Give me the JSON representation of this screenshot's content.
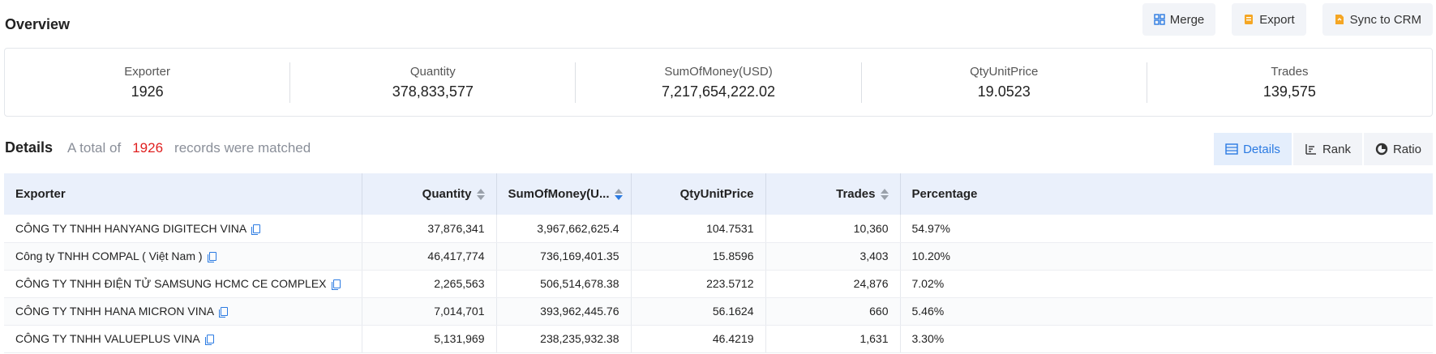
{
  "overview": {
    "title": "Overview"
  },
  "actions": {
    "merge": "Merge",
    "export": "Export",
    "sync": "Sync to CRM"
  },
  "stats": [
    {
      "label": "Exporter",
      "value": "1926"
    },
    {
      "label": "Quantity",
      "value": "378,833,577"
    },
    {
      "label": "SumOfMoney(USD)",
      "value": "7,217,654,222.02"
    },
    {
      "label": "QtyUnitPrice",
      "value": "19.0523"
    },
    {
      "label": "Trades",
      "value": "139,575"
    }
  ],
  "details": {
    "title": "Details",
    "prefix": "A total of",
    "count": "1926",
    "suffix": "records were matched"
  },
  "view_tabs": {
    "details": "Details",
    "rank": "Rank",
    "ratio": "Ratio"
  },
  "table": {
    "headers": [
      "Exporter",
      "Quantity",
      "SumOfMoney(U...",
      "QtyUnitPrice",
      "Trades",
      "Percentage"
    ],
    "rows": [
      [
        "CÔNG TY TNHH HANYANG DIGITECH VINA",
        "37,876,341",
        "3,967,662,625.4",
        "104.7531",
        "10,360",
        "54.97%"
      ],
      [
        "Công ty TNHH COMPAL ( Việt Nam )",
        "46,417,774",
        "736,169,401.35",
        "15.8596",
        "3,403",
        "10.20%"
      ],
      [
        "CÔNG TY TNHH ĐIỆN TỬ SAMSUNG HCMC CE COMPLEX",
        "2,265,563",
        "506,514,678.38",
        "223.5712",
        "24,876",
        "7.02%"
      ],
      [
        "CÔNG TY TNHH HANA MICRON VINA",
        "7,014,701",
        "393,962,445.76",
        "56.1624",
        "660",
        "5.46%"
      ],
      [
        "CÔNG TY TNHH VALUEPLUS VINA",
        "5,131,969",
        "238,235,932.38",
        "46.4219",
        "1,631",
        "3.30%"
      ]
    ]
  },
  "colors": {
    "accent": "#2a7ae2",
    "count": "#e02020",
    "header_bg": "#eaf0fb",
    "icon_orange": "#f5a623"
  }
}
